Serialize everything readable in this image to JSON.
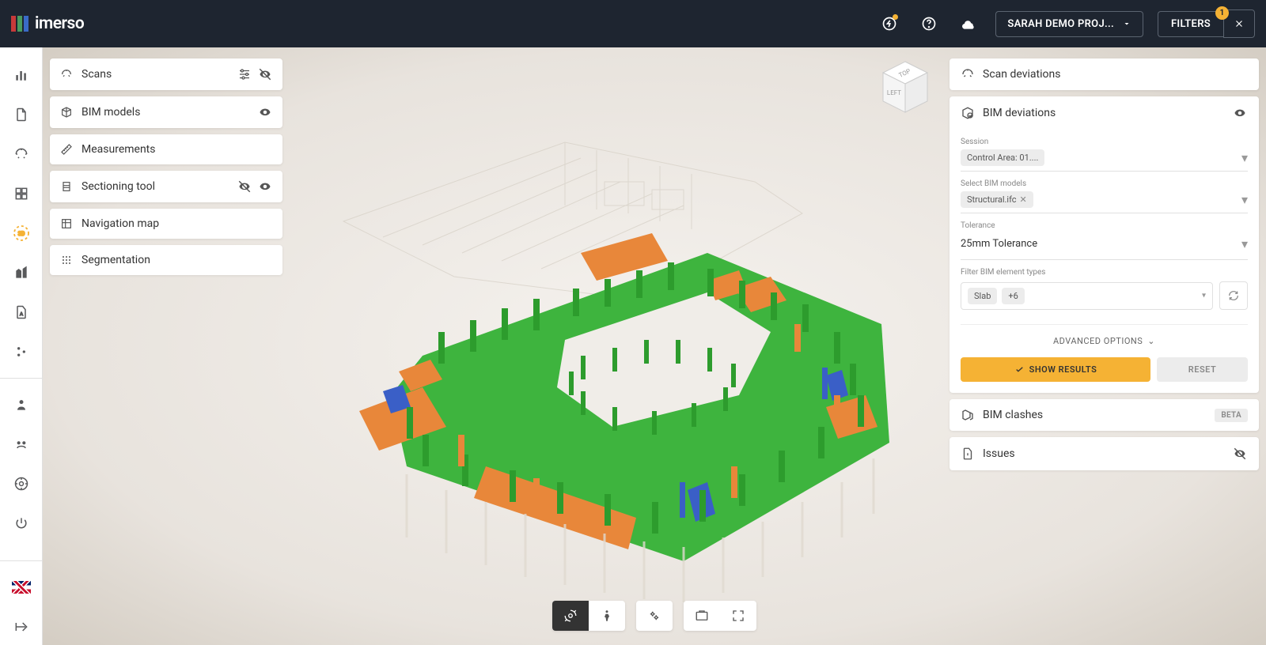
{
  "header": {
    "logo_text": "imerso",
    "project_name": "SARAH DEMO PROJ...",
    "filters_label": "FILTERS",
    "filters_count": "1"
  },
  "tools": {
    "scans": "Scans",
    "bim_models": "BIM models",
    "measurements": "Measurements",
    "sectioning": "Sectioning tool",
    "navigation": "Navigation map",
    "segmentation": "Segmentation"
  },
  "orient": {
    "top": "TOP",
    "left": "LEFT"
  },
  "right_panel": {
    "scan_dev": "Scan deviations",
    "bim_dev": "BIM deviations",
    "session_label": "Session",
    "session_value": "Control Area: 01....",
    "select_models_label": "Select BIM models",
    "model_chip": "Structural.ifc",
    "tolerance_label": "Tolerance",
    "tolerance_value": "25mm Tolerance",
    "filter_label": "Filter BIM element types",
    "filter_chip1": "Slab",
    "filter_chip2": "+6",
    "advanced": "ADVANCED OPTIONS",
    "show_results": "SHOW RESULTS",
    "reset": "RESET",
    "bim_clashes": "BIM clashes",
    "beta": "BETA",
    "issues": "Issues"
  }
}
